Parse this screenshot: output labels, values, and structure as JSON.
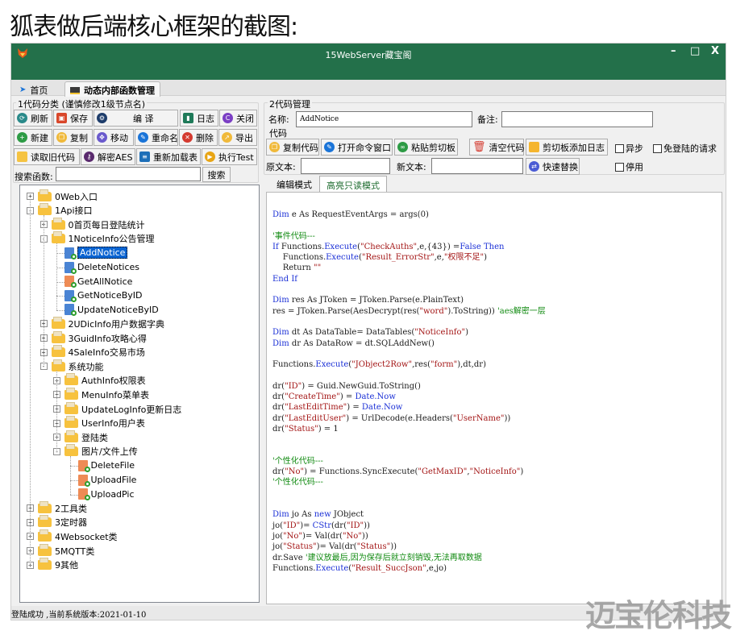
{
  "caption": "狐表做后端核心框架的截图:",
  "window": {
    "title": "15WebServer藏宝阁",
    "controls": {
      "minimize": "–",
      "maximize": "□",
      "close": "X"
    }
  },
  "tabs": [
    {
      "label": "首页",
      "icon": "navigation-arrow-icon"
    },
    {
      "label": "动态内部函数管理",
      "icon": "terminal-icon",
      "active": true
    }
  ],
  "left_panel": {
    "group_title": "1代码分类  (谨慎修改1级节点名)",
    "row1": [
      {
        "label": "刷新",
        "icon": "refresh-icon",
        "color": "#2a8a8a"
      },
      {
        "label": "保存",
        "icon": "save-icon",
        "color": "#d9472b"
      },
      {
        "label": "编 译",
        "icon": "compile-icon",
        "color": "#1e3d6b"
      },
      {
        "label": "日志",
        "icon": "log-book-icon",
        "color": "#1f7a59"
      },
      {
        "label": "关闭",
        "icon": "close-circle-icon",
        "color": "#7b3fc4"
      }
    ],
    "row2": [
      {
        "label": "新建",
        "icon": "plus-icon",
        "color": "#2d9b45"
      },
      {
        "label": "复制",
        "icon": "copy-icon",
        "color": "#f0b93a"
      },
      {
        "label": "移动",
        "icon": "move-icon",
        "color": "#6a5acd"
      },
      {
        "label": "重命名",
        "icon": "pencil-icon",
        "color": "#1a74d8"
      },
      {
        "label": "删除",
        "icon": "delete-x-icon",
        "color": "#d43a2f"
      },
      {
        "label": "导出",
        "icon": "export-icon",
        "color": "#f0b93a"
      }
    ],
    "row3": [
      {
        "label": "读取旧代码",
        "icon": "folder-open-icon",
        "color": "#f5c342"
      },
      {
        "label": "解密AES",
        "icon": "key-icon",
        "color": "#5a2a6e"
      },
      {
        "label": "重新加载表",
        "icon": "database-icon",
        "color": "#1d6fb8"
      },
      {
        "label": "执行Test",
        "icon": "play-icon",
        "color": "#e8a515"
      }
    ],
    "search": {
      "label": "搜索函数:",
      "value": "",
      "button": "搜索"
    }
  },
  "tree": [
    {
      "label": "0Web入口",
      "level": 0,
      "type": "folder",
      "expander": "+"
    },
    {
      "label": "1Api接口",
      "level": 0,
      "type": "folder",
      "expander": "-"
    },
    {
      "label": "0首页每日登陆统计",
      "level": 1,
      "type": "folder",
      "expander": "+"
    },
    {
      "label": "1NoticeInfo公告管理",
      "level": 1,
      "type": "folder",
      "expander": "-"
    },
    {
      "label": "AddNotice",
      "level": 2,
      "type": "file-blue",
      "selected": true
    },
    {
      "label": "DeleteNotices",
      "level": 2,
      "type": "file-blue"
    },
    {
      "label": "GetAllNotice",
      "level": 2,
      "type": "file-orange"
    },
    {
      "label": "GetNoticeByID",
      "level": 2,
      "type": "file-blue"
    },
    {
      "label": "UpdateNoticeByID",
      "level": 2,
      "type": "file-blue"
    },
    {
      "label": "2UDicInfo用户数据字典",
      "level": 1,
      "type": "folder",
      "expander": "+"
    },
    {
      "label": "3GuidInfo攻略心得",
      "level": 1,
      "type": "folder",
      "expander": "+"
    },
    {
      "label": "4SaleInfo交易市场",
      "level": 1,
      "type": "folder",
      "expander": "+"
    },
    {
      "label": "系统功能",
      "level": 1,
      "type": "folder",
      "expander": "-"
    },
    {
      "label": "AuthInfo权限表",
      "level": 2,
      "type": "folder",
      "expander": "+"
    },
    {
      "label": "MenuInfo菜单表",
      "level": 2,
      "type": "folder",
      "expander": "+"
    },
    {
      "label": "UpdateLogInfo更新日志",
      "level": 2,
      "type": "folder",
      "expander": "+"
    },
    {
      "label": "UserInfo用户表",
      "level": 2,
      "type": "folder",
      "expander": "+"
    },
    {
      "label": "登陆类",
      "level": 2,
      "type": "folder",
      "expander": "+"
    },
    {
      "label": "图片/文件上传",
      "level": 2,
      "type": "folder",
      "expander": "-"
    },
    {
      "label": "DeleteFile",
      "level": 3,
      "type": "file-orange"
    },
    {
      "label": "UploadFile",
      "level": 3,
      "type": "file-orange"
    },
    {
      "label": "UploadPic",
      "level": 3,
      "type": "file-orange"
    },
    {
      "label": "2工具类",
      "level": 0,
      "type": "folder",
      "expander": "+"
    },
    {
      "label": "3定时器",
      "level": 0,
      "type": "folder",
      "expander": "+"
    },
    {
      "label": "4Websocket类",
      "level": 0,
      "type": "folder",
      "expander": "+"
    },
    {
      "label": "5MQTT类",
      "level": 0,
      "type": "folder",
      "expander": "+"
    },
    {
      "label": "9其他",
      "level": 0,
      "type": "folder",
      "expander": "+"
    }
  ],
  "right_panel": {
    "group_title": "2代码管理",
    "name_label": "名称:",
    "name_value": "AddNotice",
    "remark_label": "备注:",
    "remark_value": "",
    "code_label": "代码",
    "buttons": [
      {
        "label": "复制代码",
        "icon": "copy-icon",
        "color": "#f0b93a"
      },
      {
        "label": "打开命令窗口",
        "icon": "pencil-icon",
        "color": "#1a74d8"
      },
      {
        "label": "粘贴剪切板",
        "icon": "paste-icon",
        "color": "#2d9b45"
      },
      {
        "label": "清空代码",
        "icon": "trash-icon",
        "color": "#d43a2f"
      },
      {
        "label": "剪切板添加日志",
        "icon": "clipboard-note-icon",
        "color": "#f5b52e"
      }
    ],
    "checkboxes": [
      {
        "label": "异步",
        "checked": false
      },
      {
        "label": "免登陆的请求",
        "checked": false
      },
      {
        "label": "停用",
        "checked": false
      }
    ],
    "old_text_label": "原文本:",
    "old_text_value": "",
    "new_text_label": "新文本:",
    "new_text_value": "",
    "replace_button": {
      "label": "快速替换",
      "icon": "replace-icon",
      "color": "#4a5bd4"
    },
    "code_tabs": [
      {
        "label": "编辑模式"
      },
      {
        "label": "高亮只读模式",
        "active": true
      }
    ]
  },
  "code_lines": [
    [
      [
        "kw",
        "Dim"
      ],
      [
        "t",
        " e As RequestEventArgs = args(0)"
      ]
    ],
    [],
    [
      [
        "cm",
        "'事件代码---"
      ]
    ],
    [
      [
        "kw",
        "If"
      ],
      [
        "t",
        " Functions."
      ],
      [
        "kw",
        "Execute"
      ],
      [
        "t",
        "("
      ],
      [
        "str",
        "\"CheckAuths\""
      ],
      [
        "t",
        ",e,{43}) ="
      ],
      [
        "kw",
        "False Then"
      ]
    ],
    [
      [
        "t",
        "    Functions."
      ],
      [
        "kw",
        "Execute"
      ],
      [
        "t",
        "("
      ],
      [
        "str",
        "\"Result_ErrorStr\""
      ],
      [
        "t",
        ",e,"
      ],
      [
        "str",
        "\"权限不足\""
      ],
      [
        "t",
        ")"
      ]
    ],
    [
      [
        "t",
        "    Return "
      ],
      [
        "str",
        "\"\""
      ]
    ],
    [
      [
        "kw",
        "End If"
      ]
    ],
    [],
    [
      [
        "kw",
        "Dim"
      ],
      [
        "t",
        " res As JToken = JToken.Parse(e.PlainText)"
      ]
    ],
    [
      [
        "t",
        "res = JToken.Parse(AesDecrypt(res("
      ],
      [
        "str",
        "\"word\""
      ],
      [
        "t",
        ").ToString)) "
      ],
      [
        "cm",
        "'aes解密一层"
      ]
    ],
    [],
    [
      [
        "kw",
        "Dim"
      ],
      [
        "t",
        " dt As DataTable= DataTables("
      ],
      [
        "str",
        "\"NoticeInfo\""
      ],
      [
        "t",
        ")"
      ]
    ],
    [
      [
        "kw",
        "Dim"
      ],
      [
        "t",
        " dr As DataRow = dt.SQLAddNew()"
      ]
    ],
    [],
    [
      [
        "t",
        "Functions."
      ],
      [
        "kw",
        "Execute"
      ],
      [
        "t",
        "("
      ],
      [
        "str",
        "\"JObject2Row\""
      ],
      [
        "t",
        ",res("
      ],
      [
        "str",
        "\"form\""
      ],
      [
        "t",
        "),dt,dr)"
      ]
    ],
    [],
    [
      [
        "t",
        "dr("
      ],
      [
        "str",
        "\"ID\""
      ],
      [
        "t",
        ") = Guid.NewGuid.ToString()"
      ]
    ],
    [
      [
        "t",
        "dr("
      ],
      [
        "str",
        "\"CreateTime\""
      ],
      [
        "t",
        ") = "
      ],
      [
        "kw",
        "Date.Now"
      ]
    ],
    [
      [
        "t",
        "dr("
      ],
      [
        "str",
        "\"LastEditTime\""
      ],
      [
        "t",
        ") = "
      ],
      [
        "kw",
        "Date.Now"
      ]
    ],
    [
      [
        "t",
        "dr("
      ],
      [
        "str",
        "\"LastEditUser\""
      ],
      [
        "t",
        ") = UrlDecode(e.Headers("
      ],
      [
        "str",
        "\"UserName\""
      ],
      [
        "t",
        "))"
      ]
    ],
    [
      [
        "t",
        "dr("
      ],
      [
        "str",
        "\"Status\""
      ],
      [
        "t",
        ") = 1"
      ]
    ],
    [],
    [],
    [
      [
        "cm",
        "'个性化代码---"
      ]
    ],
    [
      [
        "t",
        "dr("
      ],
      [
        "str",
        "\"No\""
      ],
      [
        "t",
        ") = Functions.SyncExecute("
      ],
      [
        "str",
        "\"GetMaxID\""
      ],
      [
        "t",
        ","
      ],
      [
        "str",
        "\"NoticeInfo\""
      ],
      [
        "t",
        ")"
      ]
    ],
    [
      [
        "cm",
        "'个性化代码---"
      ]
    ],
    [],
    [],
    [
      [
        "kw",
        "Dim"
      ],
      [
        "t",
        " jo As "
      ],
      [
        "kw",
        "new"
      ],
      [
        "t",
        " JObject"
      ]
    ],
    [
      [
        "t",
        "jo("
      ],
      [
        "str",
        "\"ID\""
      ],
      [
        "t",
        ")= "
      ],
      [
        "kw",
        "CStr"
      ],
      [
        "t",
        "(dr("
      ],
      [
        "str",
        "\"ID\""
      ],
      [
        "t",
        "))"
      ]
    ],
    [
      [
        "t",
        "jo("
      ],
      [
        "str",
        "\"No\""
      ],
      [
        "t",
        ")= Val(dr("
      ],
      [
        "str",
        "\"No\""
      ],
      [
        "t",
        "))"
      ]
    ],
    [
      [
        "t",
        "jo("
      ],
      [
        "str",
        "\"Status\""
      ],
      [
        "t",
        ")= Val(dr("
      ],
      [
        "str",
        "\"Status\""
      ],
      [
        "t",
        "))"
      ]
    ],
    [
      [
        "t",
        "dr.Save "
      ],
      [
        "cm",
        "'建议放最后,因为保存后就立刻销毁,无法再取数据"
      ]
    ],
    [
      [
        "t",
        "Functions."
      ],
      [
        "kw",
        "Execute"
      ],
      [
        "t",
        "("
      ],
      [
        "str",
        "\"Result_SuccJson\""
      ],
      [
        "t",
        ",e,jo)"
      ]
    ]
  ],
  "statusbar": {
    "text": "登陆成功  ,当前系统版本:2021-01-10"
  },
  "watermark": "迈宝伦科技"
}
